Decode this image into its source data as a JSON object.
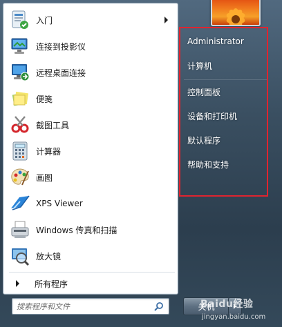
{
  "left_pane": {
    "items": [
      {
        "label": "入门",
        "icon": "getting-started-icon",
        "has_submenu": true
      },
      {
        "label": "连接到投影仪",
        "icon": "projector-icon",
        "has_submenu": false
      },
      {
        "label": "远程桌面连接",
        "icon": "remote-desktop-icon",
        "has_submenu": false
      },
      {
        "label": "便笺",
        "icon": "sticky-notes-icon",
        "has_submenu": false
      },
      {
        "label": "截图工具",
        "icon": "snipping-tool-icon",
        "has_submenu": false
      },
      {
        "label": "计算器",
        "icon": "calculator-icon",
        "has_submenu": false
      },
      {
        "label": "画图",
        "icon": "paint-icon",
        "has_submenu": false
      },
      {
        "label": "XPS Viewer",
        "icon": "xps-viewer-icon",
        "has_submenu": false
      },
      {
        "label": "Windows 传真和扫描",
        "icon": "fax-scan-icon",
        "has_submenu": false
      },
      {
        "label": "放大镜",
        "icon": "magnifier-icon",
        "has_submenu": false
      }
    ],
    "all_programs": "所有程序"
  },
  "search": {
    "placeholder": "搜索程序和文件"
  },
  "right_pane": {
    "items": [
      {
        "label": "Administrator"
      },
      {
        "label": "计算机"
      },
      {
        "label": "控制面板"
      },
      {
        "label": "设备和打印机"
      },
      {
        "label": "默认程序"
      },
      {
        "label": "帮助和支持"
      }
    ],
    "highlight_color": "#e0242f"
  },
  "shutdown": {
    "label": "关机"
  },
  "watermark": {
    "logo": "Baidu经验",
    "url": "jingyan.baidu.com"
  }
}
